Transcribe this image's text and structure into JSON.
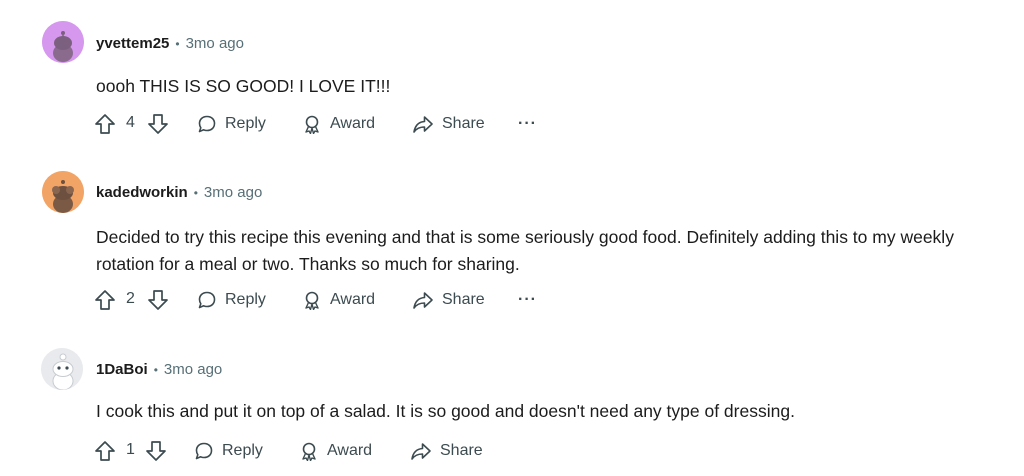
{
  "comments": [
    {
      "username": "yvettem25",
      "separator": "•",
      "time": "3mo ago",
      "text": "oooh THIS IS SO GOOD! I LOVE IT!!!",
      "votes": "4",
      "avatar_color": "#d698ee",
      "reply_label": "Reply",
      "award_label": "Award",
      "share_label": "Share",
      "more_label": "···"
    },
    {
      "username": "kadedworkin",
      "separator": "•",
      "time": "3mo ago",
      "text": "Decided to try this recipe this evening and that is some seriously good food. Definitely adding this to my weekly rotation for a meal or two. Thanks so much for sharing.",
      "votes": "2",
      "avatar_color": "#f2a466",
      "reply_label": "Reply",
      "award_label": "Award",
      "share_label": "Share",
      "more_label": "···"
    },
    {
      "username": "1DaBoi",
      "separator": "•",
      "time": "3mo ago",
      "text": "I cook this and put it on top of a salad. It is so good and doesn't need any type of dressing.",
      "votes": "1",
      "avatar_color": "#e8eaed",
      "reply_label": "Reply",
      "award_label": "Award",
      "share_label": "Share",
      "more_label": "···"
    }
  ]
}
